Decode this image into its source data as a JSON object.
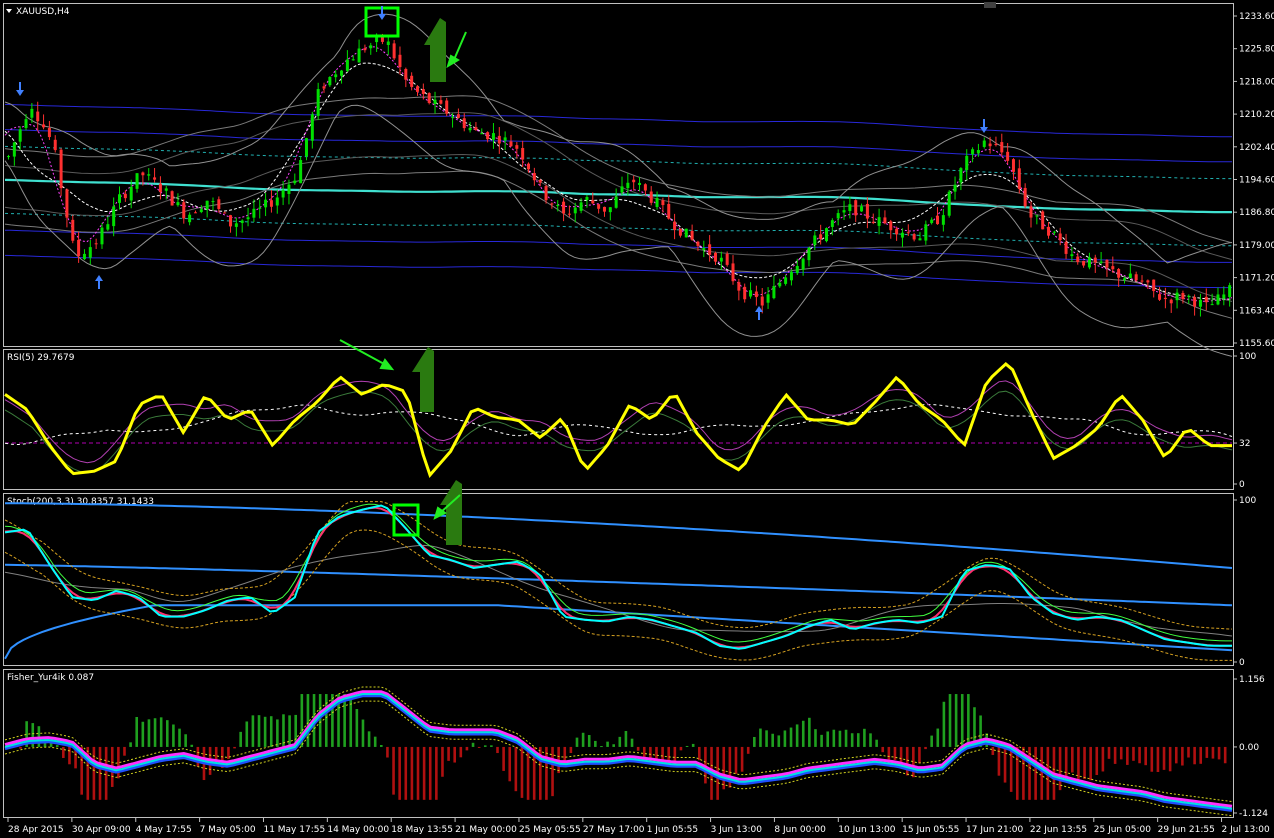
{
  "chart_title": "XAUUSD,H4",
  "chart_data": [
    {
      "type": "candlestick",
      "title": "XAUUSD,H4",
      "y_ticks": [
        "1233.60",
        "1225.80",
        "1218.00",
        "1210.20",
        "1202.40",
        "1194.60",
        "1186.80",
        "1179.00",
        "1171.20",
        "1163.40",
        "1155.60"
      ],
      "ylim": [
        1155.6,
        1233.6
      ],
      "annotations": [
        "down-arrow",
        "up-arrow",
        "green-square",
        "green-arrow"
      ],
      "colors": {
        "bull": "#00e000",
        "bear": "#ff3030",
        "ma_long": "#40e0d0",
        "bands": "#3030ff",
        "envelope": "#808080"
      },
      "close_path": [
        1200,
        1213,
        1203,
        1176,
        1180,
        1190,
        1196,
        1192,
        1186,
        1190,
        1184,
        1186,
        1190,
        1196,
        1216,
        1222,
        1226,
        1228,
        1217,
        1213,
        1210,
        1206,
        1205,
        1202,
        1192,
        1186,
        1190,
        1187,
        1195,
        1190,
        1184,
        1179,
        1176,
        1168,
        1165,
        1172,
        1178,
        1184,
        1188,
        1185,
        1183,
        1181,
        1186,
        1198,
        1204,
        1200,
        1186,
        1182,
        1176,
        1174,
        1172,
        1170,
        1166,
        1167,
        1164,
        1168
      ]
    },
    {
      "type": "line",
      "title": "RSI(5) 29.7679",
      "y_ticks": [
        "100",
        "32",
        "0"
      ],
      "ylim": [
        0,
        100
      ],
      "level": 32,
      "series": [
        {
          "name": "RSI(5)",
          "color": "#ffff00",
          "values": [
            70,
            58,
            30,
            8,
            10,
            18,
            62,
            70,
            40,
            70,
            50,
            58,
            30,
            50,
            64,
            84,
            70,
            78,
            72,
            6,
            26,
            60,
            52,
            50,
            36,
            52,
            10,
            30,
            62,
            50,
            72,
            40,
            20,
            10,
            44,
            70,
            50,
            50,
            46,
            64,
            84,
            62,
            50,
            30,
            80,
            96,
            56,
            20,
            30,
            44,
            70,
            50,
            20,
            44,
            30,
            30
          ]
        }
      ]
    },
    {
      "type": "line",
      "title": "Stoch(200,3,3) 30.8357 31.1433",
      "y_ticks": [
        "100",
        "0"
      ],
      "ylim": [
        0,
        100
      ],
      "series": [
        {
          "name": "Stoch",
          "color": "#00ffff",
          "values": [
            80,
            82,
            60,
            40,
            38,
            44,
            40,
            28,
            28,
            32,
            38,
            40,
            30,
            40,
            80,
            90,
            94,
            97,
            82,
            66,
            63,
            58,
            60,
            62,
            54,
            28,
            26,
            25,
            28,
            26,
            22,
            18,
            10,
            8,
            12,
            16,
            22,
            26,
            20,
            24,
            26,
            24,
            28,
            56,
            60,
            58,
            40,
            30,
            26,
            28,
            26,
            20,
            14,
            12,
            10,
            10
          ]
        }
      ]
    },
    {
      "type": "line",
      "title": "Fisher_Yur4ik 0.087",
      "y_ticks": [
        "1.156",
        "0.00",
        "-1.124"
      ],
      "ylim": [
        -1.124,
        1.156
      ],
      "series": [
        {
          "name": "Fisher",
          "color": "#00e0e0",
          "values": [
            0,
            0.1,
            0.12,
            0.05,
            -0.3,
            -0.4,
            -0.3,
            -0.2,
            -0.15,
            -0.25,
            -0.3,
            -0.2,
            -0.1,
            0,
            0.5,
            0.8,
            0.9,
            0.9,
            0.6,
            0.3,
            0.25,
            0.25,
            0.25,
            0.1,
            -0.2,
            -0.3,
            -0.25,
            -0.25,
            -0.2,
            -0.25,
            -0.3,
            -0.3,
            -0.5,
            -0.6,
            -0.55,
            -0.5,
            -0.4,
            -0.35,
            -0.3,
            -0.25,
            -0.3,
            -0.4,
            -0.35,
            0,
            0.1,
            0,
            -0.25,
            -0.5,
            -0.6,
            -0.7,
            -0.75,
            -0.8,
            -0.9,
            -0.95,
            -1.0,
            -1.05
          ]
        }
      ]
    }
  ],
  "x_labels": [
    "28 Apr 2015",
    "30 Apr 09:00",
    "4 May 17:55",
    "7 May 05:00",
    "11 May 17:55",
    "14 May 00:00",
    "18 May 13:55",
    "21 May 00:00",
    "25 May 05:55",
    "27 May 17:00",
    "1 Jun 05:55",
    "3 Jun 13:00",
    "8 Jun 00:00",
    "10 Jun 13:00",
    "15 Jun 05:55",
    "17 Jun 21:00",
    "22 Jun 13:55",
    "25 Jun 05:00",
    "29 Jun 21:55",
    "2 Jul 13:00"
  ]
}
